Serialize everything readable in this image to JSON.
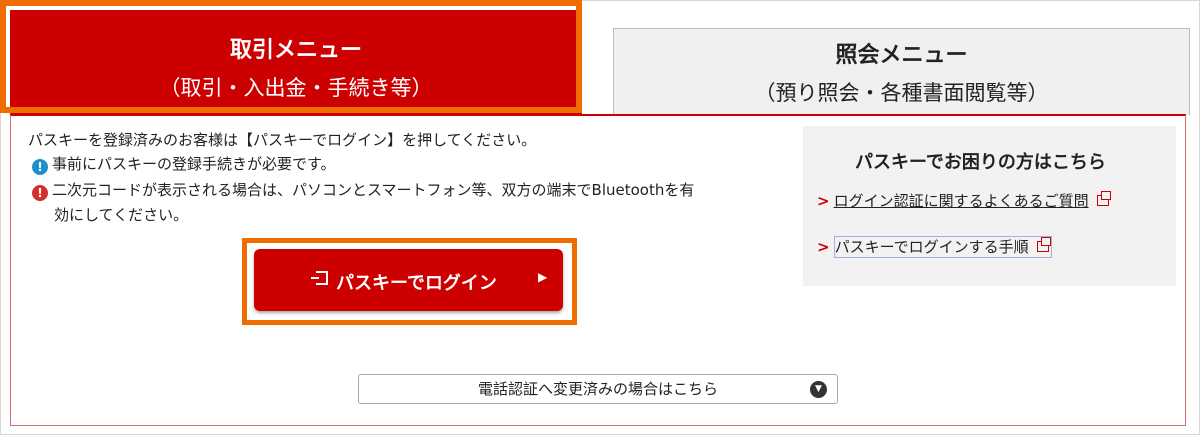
{
  "tabs": {
    "trade": {
      "title": "取引メニュー",
      "subtitle": "（取引・入出金・手続き等）"
    },
    "inquiry": {
      "title": "照会メニュー",
      "subtitle": "（預り照会・各種書面閲覧等）"
    }
  },
  "content": {
    "intro": "パスキーを登録済みのお客様は【パスキーでログイン】を押してください。",
    "note_info": "事前にパスキーの登録手続きが必要です。",
    "note_warn_line1": "二次元コードが表示される場合は、パソコンとスマートフォン等、双方の端末でBluetoothを有",
    "note_warn_line2": "効にしてください。",
    "login_button": "パスキーでログイン",
    "login_arrow": "▶"
  },
  "help": {
    "title": "パスキーでお困りの方はこちら",
    "links": [
      {
        "label": "ログイン認証に関するよくあるご質問",
        "chev": ">"
      },
      {
        "label": "パスキーでログインする手順",
        "chev": ">"
      }
    ]
  },
  "toggle": {
    "label": "電話認証へ変更済みの場合はこちら",
    "icon": "▼"
  },
  "icons": {
    "info": "!",
    "warn": "!"
  },
  "colors": {
    "brand_red": "#cc0000",
    "highlight_orange": "#ee6d00",
    "info_blue": "#1e8fcc"
  }
}
